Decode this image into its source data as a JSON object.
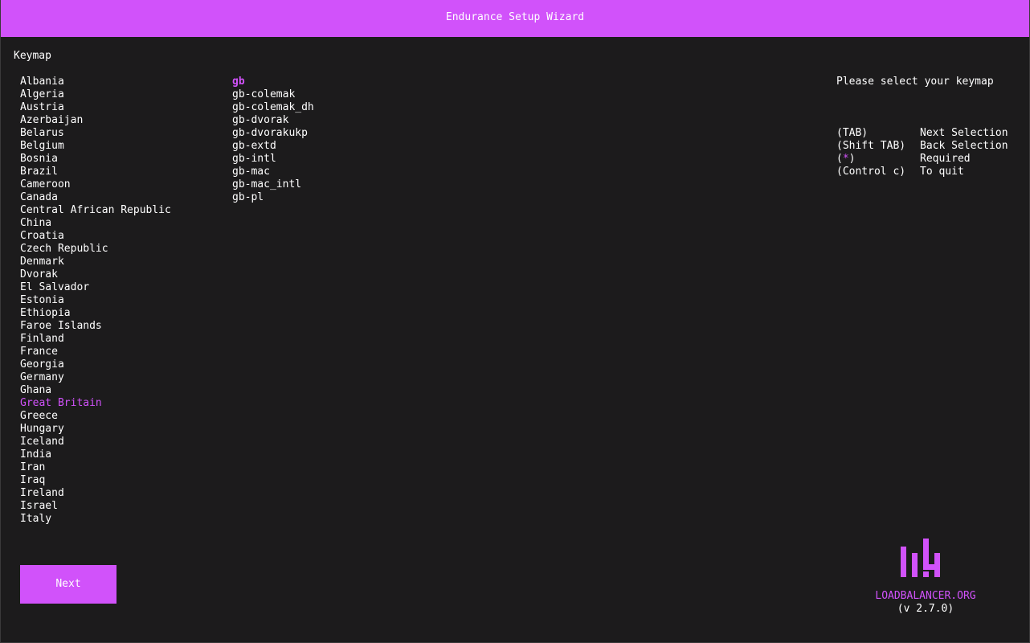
{
  "window": {
    "title": "Endurance Setup Wizard"
  },
  "form": {
    "section_label": "Keymap",
    "countries": [
      "Albania",
      "Algeria",
      "Austria",
      "Azerbaijan",
      "Belarus",
      "Belgium",
      "Bosnia",
      "Brazil",
      "Cameroon",
      "Canada",
      "Central African Republic",
      "China",
      "Croatia",
      "Czech Republic",
      "Denmark",
      "Dvorak",
      "El Salvador",
      "Estonia",
      "Ethiopia",
      "Faroe Islands",
      "Finland",
      "France",
      "Georgia",
      "Germany",
      "Ghana",
      "Great Britain",
      "Greece",
      "Hungary",
      "Iceland",
      "India",
      "Iran",
      "Iraq",
      "Ireland",
      "Israel",
      "Italy"
    ],
    "selected_country": "Great Britain",
    "variants": [
      "gb",
      "gb-colemak",
      "gb-colemak_dh",
      "gb-dvorak",
      "gb-dvorakukp",
      "gb-extd",
      "gb-intl",
      "gb-mac",
      "gb-mac_intl",
      "gb-pl"
    ],
    "selected_variant": "gb",
    "next_label": "Next"
  },
  "help": {
    "prompt": "Please select your keymap",
    "shortcuts": [
      {
        "key": "(TAB)",
        "action": "Next Selection"
      },
      {
        "key": "(Shift TAB)",
        "action": "Back Selection"
      },
      {
        "key_prefix": "(",
        "key_star": "*",
        "key_suffix": ")",
        "action": "Required"
      },
      {
        "key": "(Control c)",
        "action": "To quit"
      }
    ]
  },
  "branding": {
    "name": "LOADBALANCER.ORG",
    "version": "(v 2.7.0)",
    "logo_icon": "loadbalancer-logo-icon"
  },
  "colors": {
    "accent": "#d152fa",
    "background": "#1c1b1c",
    "text": "#ffffff"
  }
}
